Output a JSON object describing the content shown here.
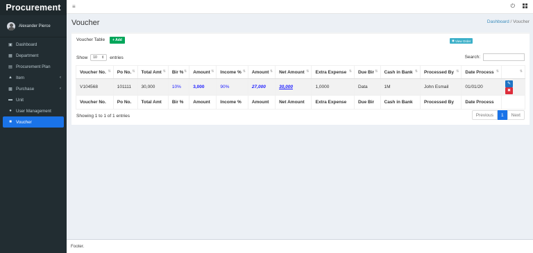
{
  "brand": "Procurement",
  "user": {
    "name": "Alexander Pierce"
  },
  "sidebar": {
    "items": [
      {
        "label": "Dashboard",
        "icon": "dashboard-icon"
      },
      {
        "label": "Department",
        "icon": "building-icon"
      },
      {
        "label": "Procurement Plan",
        "icon": "clipboard-icon"
      },
      {
        "label": "Item",
        "icon": "cart-icon",
        "has_children": true
      },
      {
        "label": "Purchase",
        "icon": "briefcase-icon",
        "has_children": true
      },
      {
        "label": "Unit",
        "icon": "truck-icon"
      },
      {
        "label": "User Management",
        "icon": "users-icon"
      },
      {
        "label": "Voucher",
        "icon": "voucher-icon",
        "active": true
      }
    ]
  },
  "header": {
    "title": "Voucher",
    "breadcrumb": {
      "home": "Dashboard",
      "sep": "/",
      "current": "Voucher"
    }
  },
  "box": {
    "title": "Voucher Table",
    "add_label": "+ Add",
    "view_order_label": "View Order",
    "show_label": "Show",
    "entries_value": "10",
    "entries_label": "entries",
    "search_label": "Search:",
    "search_value": ""
  },
  "table": {
    "columns": [
      "Voucher No.",
      "Po No.",
      "Total Amt",
      "Bir %",
      "Amount",
      "Income %",
      "Amount",
      "Net Amount",
      "Extra Expense",
      "Due Bir",
      "Cash in Bank",
      "Processed By",
      "Date Process",
      ""
    ],
    "rows": [
      {
        "voucher_no": "V104568",
        "po_no": "101111",
        "total_amt": "30,000",
        "bir_pct": "10%",
        "amount1": "3,000",
        "income_pct": "90%",
        "amount2": "27,000",
        "net_amount": "30,000",
        "extra_expense": "1,0000",
        "due_bir": "Data",
        "cash_in_bank": "1M",
        "processed_by": "John Esmail",
        "date_process": "01/01/20"
      }
    ]
  },
  "footer_info": {
    "showing": "Showing 1 to 1 of 1 entries",
    "previous": "Previous",
    "page": "1",
    "next": "Next"
  },
  "page_footer": "Footer.",
  "colors": {
    "sidebar_bg": "#222d32",
    "active": "#1a73e8",
    "add_btn": "#00a65a",
    "delete_btn": "#dd2d3b",
    "edit_btn": "#1e73c4"
  }
}
